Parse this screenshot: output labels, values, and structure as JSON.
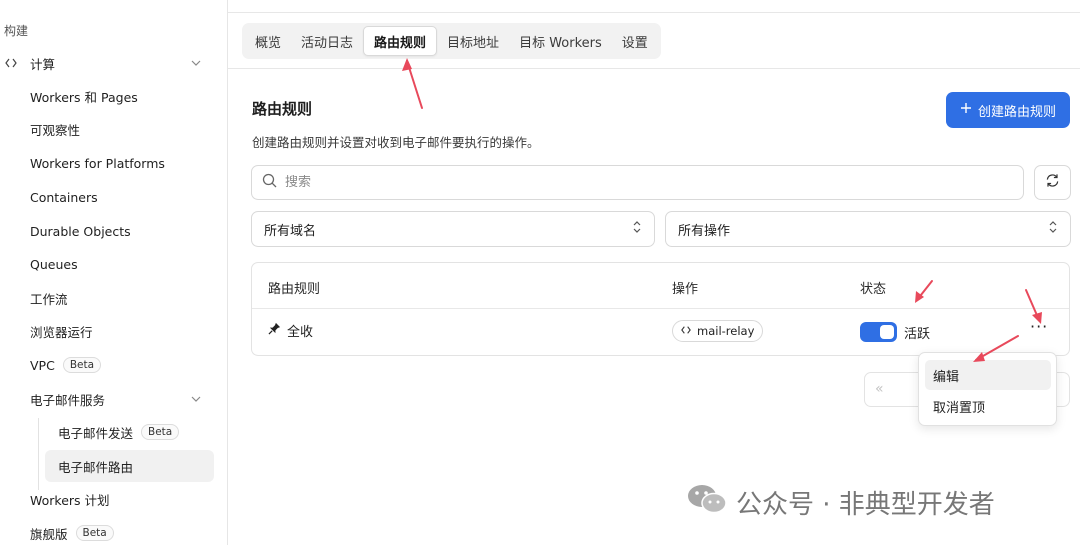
{
  "sidebar": {
    "section": "构建",
    "compute_label": "计算",
    "items": [
      {
        "label": "Workers 和 Pages"
      },
      {
        "label": "可观察性"
      },
      {
        "label": "Workers for Platforms"
      },
      {
        "label": "Containers"
      },
      {
        "label": "Durable Objects"
      },
      {
        "label": "Queues"
      },
      {
        "label": "工作流"
      },
      {
        "label": "浏览器运行"
      },
      {
        "label": "VPC",
        "badge": "Beta"
      }
    ],
    "email_group": "电子邮件服务",
    "email_sub": [
      {
        "label": "电子邮件发送",
        "badge": "Beta"
      },
      {
        "label": "电子邮件路由"
      }
    ],
    "workers_plan": "Workers 计划",
    "flagship": {
      "label": "旗舰版",
      "badge": "Beta"
    }
  },
  "tabs": [
    "概览",
    "活动日志",
    "路由规则",
    "目标地址",
    "目标 Workers",
    "设置"
  ],
  "active_tab": "路由规则",
  "page": {
    "title": "路由规则",
    "description": "创建路由规则并设置对收到电子邮件要执行的操作。",
    "create_button": "创建路由规则",
    "search_placeholder": "搜索",
    "domain_filter": "所有域名",
    "action_filter": "所有操作"
  },
  "table": {
    "headers": [
      "路由规则",
      "操作",
      "状态"
    ],
    "rows": [
      {
        "rule": "全收",
        "action": "mail-relay",
        "status": "活跃",
        "enabled": true
      }
    ]
  },
  "menu": {
    "items": [
      "编辑",
      "取消置顶"
    ]
  },
  "watermark": "公众号 · 非典型开发者",
  "colors": {
    "accent": "#2f6fe4",
    "annotation": "#e8495b"
  }
}
